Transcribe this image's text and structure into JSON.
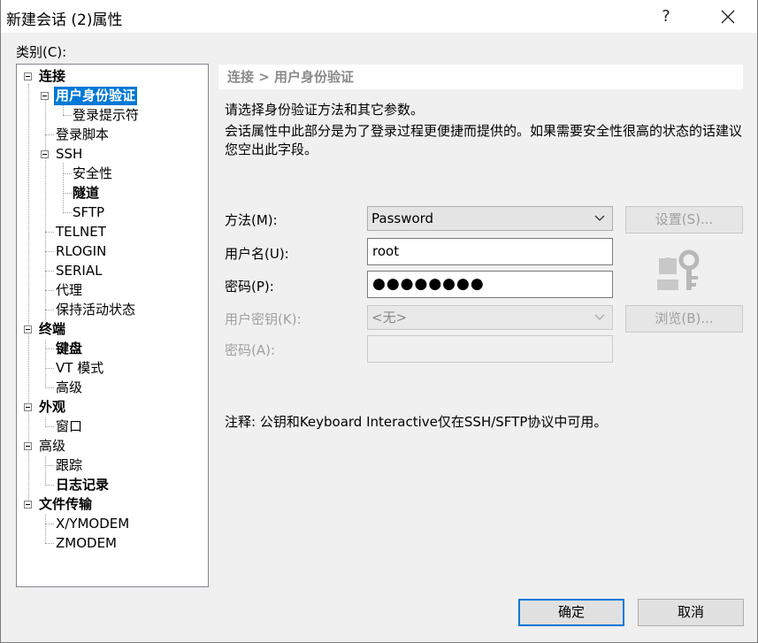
{
  "window": {
    "title": "新建会话 (2)属性",
    "help": "?"
  },
  "category_label": "类别(C):",
  "tree": {
    "connection": "连接",
    "user_auth": "用户身份验证",
    "login_prompts": "登录提示符",
    "login_scripts": "登录脚本",
    "ssh": "SSH",
    "security": "安全性",
    "tunneling": "隧道",
    "sftp": "SFTP",
    "telnet": "TELNET",
    "rlogin": "RLOGIN",
    "serial": "SERIAL",
    "proxy": "代理",
    "keepalive": "保持活动状态",
    "terminal": "终端",
    "keyboard": "键盘",
    "vt_modes": "VT 模式",
    "terminal_advanced": "高级",
    "appearance": "外观",
    "window": "窗口",
    "advanced": "高级",
    "trace": "跟踪",
    "logging": "日志记录",
    "file_transfer": "文件传输",
    "xymodem": "X/YMODEM",
    "zmodem": "ZMODEM"
  },
  "panel": {
    "breadcrumb": "连接 > 用户身份验证",
    "desc1": "请选择身份验证方法和其它参数。",
    "desc2": "会话属性中此部分是为了登录过程更便捷而提供的。如果需要安全性很高的状态的话建议您空出此字段。",
    "method_label": "方法(M):",
    "method_value": "Password",
    "settings_button": "设置(S)...",
    "username_label": "用户名(U):",
    "username_value": "root",
    "password_label": "密码(P):",
    "password_value": "●●●●●●●●",
    "user_key_label": "用户密钥(K):",
    "user_key_value": "<无>",
    "browse_button": "浏览(B)...",
    "passphrase_label": "密码(A):",
    "note": "注释: 公钥和Keyboard Interactive仅在SSH/SFTP协议中可用。"
  },
  "footer": {
    "ok": "确定",
    "cancel": "取消"
  }
}
